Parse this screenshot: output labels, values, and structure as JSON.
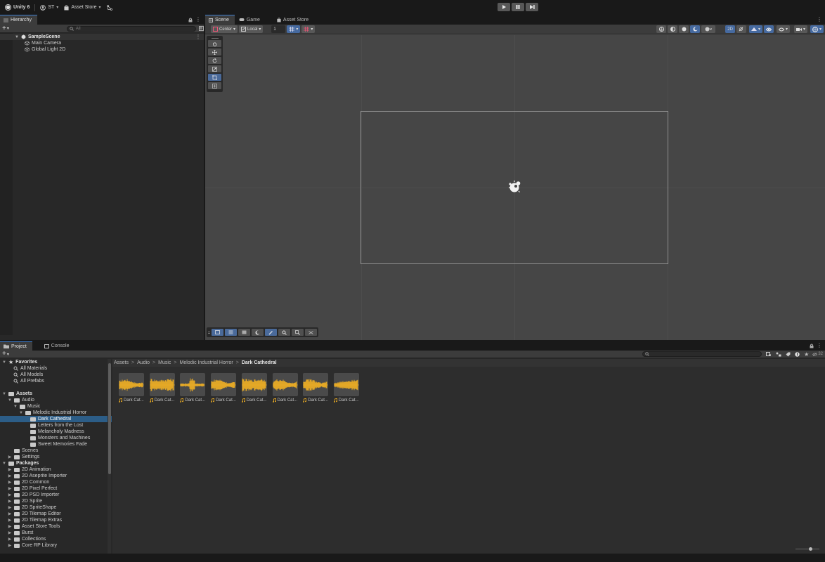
{
  "topbar": {
    "unity_label": "Unity 6",
    "account_label": "ST",
    "store_label": "Asset Store"
  },
  "hierarchy": {
    "tab_label": "Hierarchy",
    "search_placeholder": "All",
    "scene_name": "SampleScene",
    "objects": [
      "Main Camera",
      "Global Light 2D"
    ]
  },
  "scene": {
    "tabs": [
      "Scene",
      "Game",
      "Asset Store"
    ],
    "pivot_label": "Center",
    "space_label": "Local",
    "grid_value": "1",
    "mode_2d_label": "2D"
  },
  "project": {
    "tabs": [
      "Project",
      "Console"
    ],
    "breadcrumb": [
      "Assets",
      "Audio",
      "Music",
      "Melodic Industrial Horror",
      "Dark Cathedral"
    ],
    "favorites_label": "Favorites",
    "favorites": [
      "All Materials",
      "All Models",
      "All Prefabs"
    ],
    "assets_label": "Assets",
    "audio_label": "Audio",
    "music_label": "Music",
    "horror_label": "Melodic Industrial Horror",
    "horror_children": [
      "Dark Cathedral",
      "Letters from the Lost",
      "Melancholy Madness",
      "Monsters and Machines",
      "Sweet Memories Fade"
    ],
    "scenes_label": "Scenes",
    "settings_label": "Settings",
    "packages_label": "Packages",
    "packages": [
      "2D Animation",
      "2D Aseprite Importer",
      "2D Common",
      "2D Pixel Perfect",
      "2D PSD Importer",
      "2D Sprite",
      "2D SpriteShape",
      "2D Tilemap Editor",
      "2D Tilemap Extras",
      "Asset Store Tools",
      "Burst",
      "Collections",
      "Core RP Library"
    ],
    "asset_labels": [
      "Dark Cat...",
      "Dark Cat...",
      "Dark Cat...",
      "Dark Cat...",
      "Dark Cat...",
      "Dark Cat...",
      "Dark Cat...",
      "Dark Cat..."
    ],
    "hidden_count": "32"
  },
  "colors": {
    "accent": "#3d7fd2",
    "waveform": "#f2b124",
    "selection": "#2c5d87"
  }
}
